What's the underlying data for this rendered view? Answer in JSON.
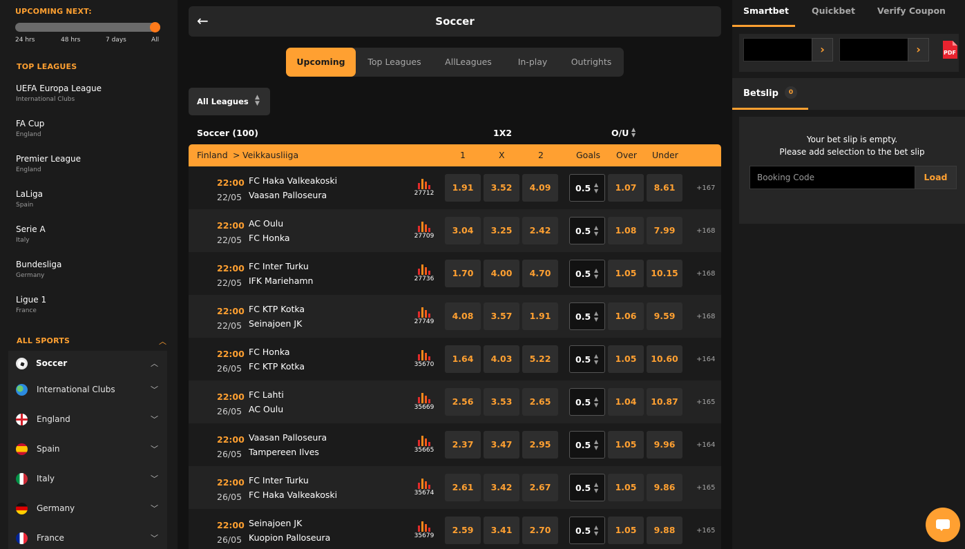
{
  "left": {
    "upcoming_title": "UPCOMING NEXT:",
    "upcoming_labels": [
      "24 hrs",
      "48 hrs",
      "7 days",
      "All"
    ],
    "top_leagues_title": "TOP LEAGUES",
    "leagues": [
      {
        "name": "UEFA Europa League",
        "country": "International Clubs"
      },
      {
        "name": "FA Cup",
        "country": "England"
      },
      {
        "name": "Premier League",
        "country": "England"
      },
      {
        "name": "LaLiga",
        "country": "Spain"
      },
      {
        "name": "Serie A",
        "country": "Italy"
      },
      {
        "name": "Bundesliga",
        "country": "Germany"
      },
      {
        "name": "Ligue 1",
        "country": "France"
      }
    ],
    "all_sports_title": "ALL SPORTS",
    "sports": [
      {
        "label": "Soccer",
        "icon": "soccer-ball-icon"
      },
      {
        "label": "International Clubs",
        "icon": "globe-icon"
      },
      {
        "label": "England",
        "icon": "england-flag-icon"
      },
      {
        "label": "Spain",
        "icon": "spain-flag-icon"
      },
      {
        "label": "Italy",
        "icon": "italy-flag-icon"
      },
      {
        "label": "Germany",
        "icon": "germany-flag-icon"
      },
      {
        "label": "France",
        "icon": "france-flag-icon"
      }
    ]
  },
  "main": {
    "title": "Soccer",
    "tabs": [
      "Upcoming",
      "Top Leagues",
      "AllLeagues",
      "In-play",
      "Outrights"
    ],
    "active_tab": "Upcoming",
    "league_select": "All Leagues",
    "sport_count": "Soccer (100)",
    "market_1x2": "1X2",
    "market_ou": "O/U",
    "breadcrumb_country": "Finland",
    "breadcrumb_sep": ">",
    "breadcrumb_league": "Veikkausliiga",
    "col_1": "1",
    "col_x": "X",
    "col_2": "2",
    "col_goals": "Goals",
    "col_over": "Over",
    "col_under": "Under",
    "matches": [
      {
        "time": "22:00",
        "date": "22/05",
        "home": "FC Haka Valkeakoski",
        "away": "Vaasan Palloseura",
        "id": "27712",
        "o1": "1.91",
        "ox": "3.52",
        "o2": "4.09",
        "goals": "0.5",
        "over": "1.07",
        "under": "8.61",
        "more": "+167"
      },
      {
        "time": "22:00",
        "date": "22/05",
        "home": "AC Oulu",
        "away": "FC Honka",
        "id": "27709",
        "o1": "3.04",
        "ox": "3.25",
        "o2": "2.42",
        "goals": "0.5",
        "over": "1.08",
        "under": "7.99",
        "more": "+168"
      },
      {
        "time": "22:00",
        "date": "22/05",
        "home": "FC Inter Turku",
        "away": "IFK Mariehamn",
        "id": "27736",
        "o1": "1.70",
        "ox": "4.00",
        "o2": "4.70",
        "goals": "0.5",
        "over": "1.05",
        "under": "10.15",
        "more": "+168"
      },
      {
        "time": "22:00",
        "date": "22/05",
        "home": "FC KTP Kotka",
        "away": "Seinajoen JK",
        "id": "27749",
        "o1": "4.08",
        "ox": "3.57",
        "o2": "1.91",
        "goals": "0.5",
        "over": "1.06",
        "under": "9.59",
        "more": "+168"
      },
      {
        "time": "22:00",
        "date": "26/05",
        "home": "FC Honka",
        "away": "FC KTP Kotka",
        "id": "35670",
        "o1": "1.64",
        "ox": "4.03",
        "o2": "5.22",
        "goals": "0.5",
        "over": "1.05",
        "under": "10.60",
        "more": "+164"
      },
      {
        "time": "22:00",
        "date": "26/05",
        "home": "FC Lahti",
        "away": "AC Oulu",
        "id": "35669",
        "o1": "2.56",
        "ox": "3.53",
        "o2": "2.65",
        "goals": "0.5",
        "over": "1.04",
        "under": "10.87",
        "more": "+165"
      },
      {
        "time": "22:00",
        "date": "26/05",
        "home": "Vaasan Palloseura",
        "away": "Tampereen Ilves",
        "id": "35665",
        "o1": "2.37",
        "ox": "3.47",
        "o2": "2.95",
        "goals": "0.5",
        "over": "1.05",
        "under": "9.96",
        "more": "+164"
      },
      {
        "time": "22:00",
        "date": "26/05",
        "home": "FC Inter Turku",
        "away": "FC Haka Valkeakoski",
        "id": "35674",
        "o1": "2.61",
        "ox": "3.42",
        "o2": "2.67",
        "goals": "0.5",
        "over": "1.05",
        "under": "9.86",
        "more": "+165"
      },
      {
        "time": "22:00",
        "date": "26/05",
        "home": "Seinajoen JK",
        "away": "Kuopion Palloseura",
        "id": "35679",
        "o1": "2.59",
        "ox": "3.41",
        "o2": "2.70",
        "goals": "0.5",
        "over": "1.05",
        "under": "9.88",
        "more": "+165"
      }
    ]
  },
  "right": {
    "tabs": [
      "Smartbet",
      "Quickbet",
      "Verify Coupon"
    ],
    "active_tab": "Smartbet",
    "betslip_title": "Betslip",
    "betslip_count": "0",
    "empty_line1": "Your bet slip is empty.",
    "empty_line2": "Please add selection to the bet slip",
    "booking_placeholder": "Booking Code",
    "load_label": "Load",
    "pdf_label": "PDF"
  },
  "colors": {
    "accent": "#ffa031",
    "panel": "#262626",
    "background": "#121212"
  }
}
